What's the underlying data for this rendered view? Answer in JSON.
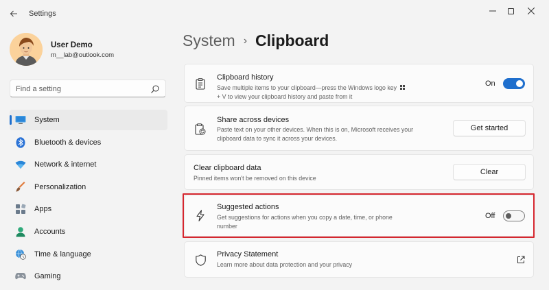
{
  "window": {
    "title": "Settings"
  },
  "profile": {
    "name": "User Demo",
    "email": "m__lab@outlook.com"
  },
  "search": {
    "placeholder": "Find a setting"
  },
  "sidebar": {
    "items": [
      {
        "label": "System",
        "icon": "monitor-icon",
        "active": true
      },
      {
        "label": "Bluetooth & devices",
        "icon": "bluetooth-icon"
      },
      {
        "label": "Network & internet",
        "icon": "wifi-icon"
      },
      {
        "label": "Personalization",
        "icon": "brush-icon"
      },
      {
        "label": "Apps",
        "icon": "apps-icon"
      },
      {
        "label": "Accounts",
        "icon": "person-icon"
      },
      {
        "label": "Time & language",
        "icon": "globe-clock-icon"
      },
      {
        "label": "Gaming",
        "icon": "gamepad-icon"
      }
    ]
  },
  "breadcrumb": {
    "parent": "System",
    "separator": "›",
    "current": "Clipboard"
  },
  "cards": {
    "history": {
      "title": "Clipboard history",
      "desc_line1": "Save multiple items to your clipboard—press the Windows logo key",
      "desc_line2": "+ V to view your clipboard history and paste from it",
      "state_label": "On",
      "state": true
    },
    "share": {
      "title": "Share across devices",
      "desc_line1": "Paste text on your other devices. When this is on, Microsoft receives your",
      "desc_line2": "clipboard data to sync it across your devices.",
      "button": "Get started"
    },
    "clear": {
      "title": "Clear clipboard data",
      "desc": "Pinned items won't be removed on this device",
      "button": "Clear"
    },
    "suggested": {
      "title": "Suggested actions",
      "desc_line1": "Get suggestions for actions when you copy a date, time, or phone",
      "desc_line2": "number",
      "state_label": "Off",
      "state": false
    },
    "privacy": {
      "title": "Privacy Statement",
      "desc": "Learn more about data protection and your privacy"
    }
  },
  "colors": {
    "accent": "#1f6fcd",
    "highlight": "#d6262e"
  }
}
